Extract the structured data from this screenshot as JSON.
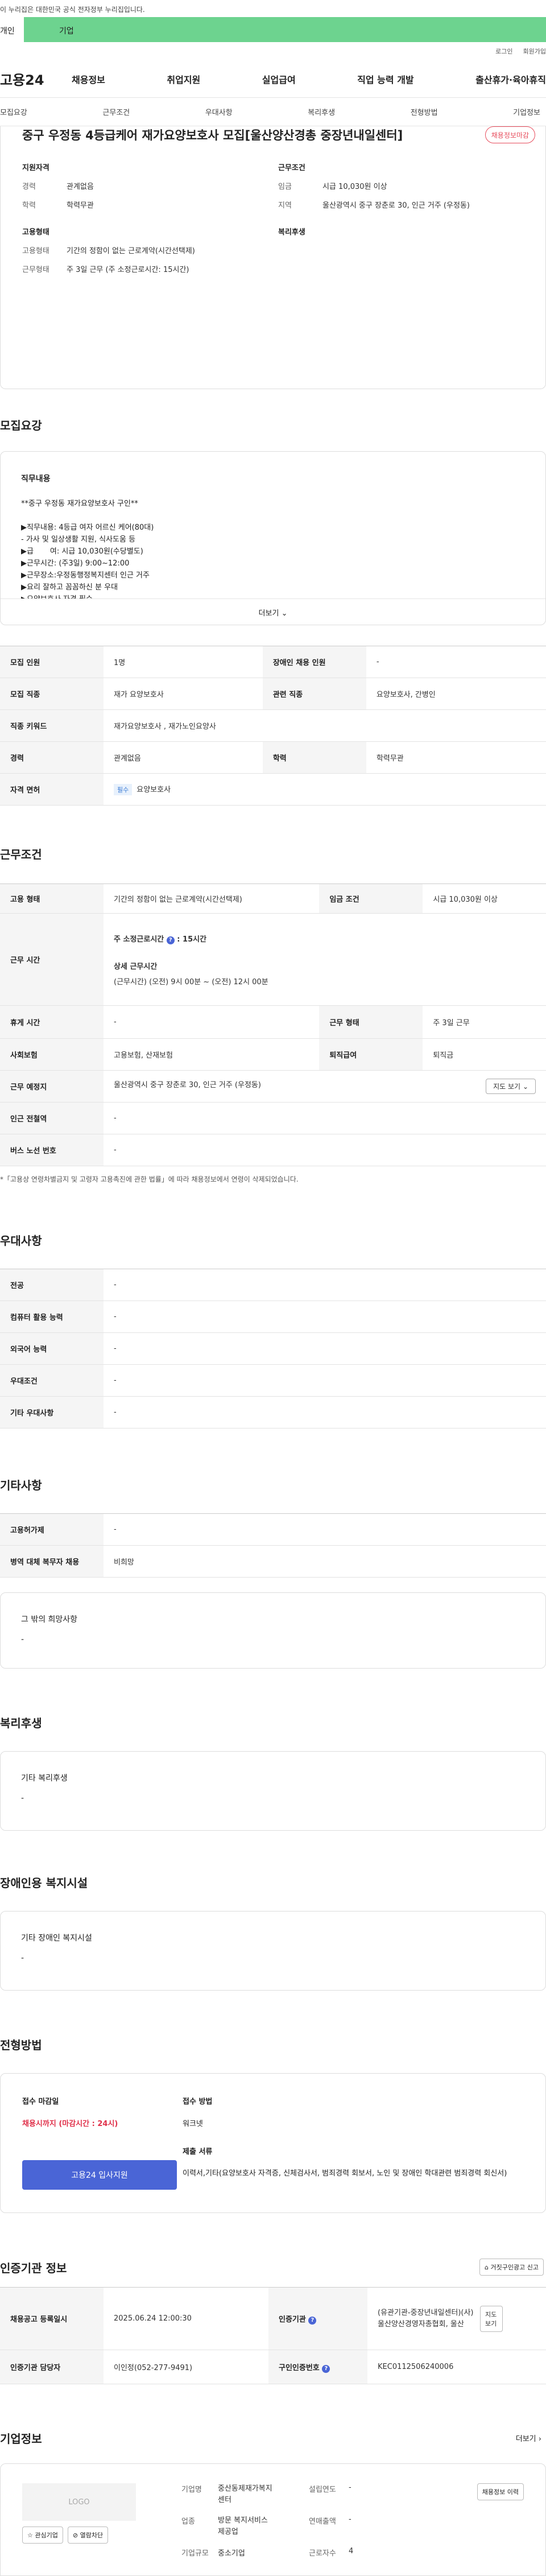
{
  "gov_notice": "이 누리집은 대한민국 공식 전자정부 누리집입니다.",
  "top_tabs": [
    "개인",
    "기업"
  ],
  "util_links": [
    "로그인",
    "회원가입"
  ],
  "logo": "고용24",
  "gnb": [
    "채용정보",
    "취업지원",
    "실업급여",
    "직업 능력 개발",
    "출산휴가·육아휴직"
  ],
  "subnav": [
    "모집요강",
    "근무조건",
    "우대사항",
    "복리후생",
    "전형방법",
    "기업정보"
  ],
  "job_title": "중구 우정동 4등급케어 재가요양보호사 모집[울산양산경총 중장년내일센터]",
  "status_badge": "채용정보마감",
  "summary": {
    "qual_title": "지원자격",
    "career_k": "경력",
    "career_v": "관계없음",
    "edu_k": "학력",
    "edu_v": "학력무관",
    "work_title": "근무조건",
    "wage_k": "임금",
    "wage_v": "시급 10,030원 이상",
    "region_k": "지역",
    "region_v": "울산광역시 중구 장춘로 30, 인근 거주 (우정동)",
    "emp_title": "고용형태",
    "emptype_k": "고용형태",
    "emptype_v": "기간의 정함이 없는 근로계약(시간선택제)",
    "hours_k": "근무형태",
    "hours_v": "주 3일 근무 (주 소정근로시간: 15시간)",
    "welfare_title": "복리후생"
  },
  "sections": {
    "recruit": "모집요강",
    "work": "근무조건",
    "pref": "우대사항",
    "etc": "기타사항",
    "welfare": "복리후생",
    "disabled": "장애인용 복지시설",
    "process": "전형방법",
    "agency": "인증기관 정보",
    "company": "기업정보"
  },
  "desc": {
    "heading": "직무내용",
    "lines": [
      "**중구 우정동 재가요양보호사 구인**",
      "",
      "▶직무내용: 4등급 여자 어르신 케어(80대)",
      " - 가사 및 일상생활 지원, 식사도움 등",
      "▶급       여: 시급 10,030원(수당별도)",
      "▶근무시간: (주3일) 9:00~12:00",
      "▶근무장소:우정동행정복지센터 인근 거주",
      "▶요리 잘하고 꼼꼼하신 분 우대",
      "▶요양보호사 자격 필수"
    ],
    "more_label": "더보기"
  },
  "recruit_table": {
    "count_k": "모집 인원",
    "count_v": "1명",
    "disabled_k": "장애인 채용 인원",
    "disabled_v": "-",
    "job_k": "모집 직종",
    "job_v": "재가 요양보호사",
    "rel_k": "관련 직종",
    "rel_v": "요양보호사, 간병인",
    "kw_k": "직종 키워드",
    "kw_v": "재가요양보호사 , 재가노인요양사",
    "career_k": "경력",
    "career_v": "관계없음",
    "edu_k": "학력",
    "edu_v": "학력무관",
    "lic_k": "자격 면허",
    "lic_chip": "필수",
    "lic_v": "요양보호사"
  },
  "work_table": {
    "type_k": "고용 형태",
    "type_v": "기간의 정함이 없는 근로계약(시간선택제)",
    "wage_k": "임금 조건",
    "wage_v": "시급 10,030원 이상",
    "time_k": "근무 시간",
    "weekly_label": "주 소정근로시간",
    "weekly_v": "15시간",
    "detail_label": "상세 근무시간",
    "detail_v": "(근무시간) (오전) 9시 00분 ~ (오전) 12시 00분",
    "break_k": "휴게 시간",
    "break_v": "-",
    "form_k": "근무 형태",
    "form_v": "주 3일 근무",
    "ins_k": "사회보험",
    "ins_v": "고용보험, 산재보험",
    "ret_k": "퇴직급여",
    "ret_v": "퇴직금",
    "place_k": "근무 예정지",
    "place_v": "울산광역시 중구 장춘로 30, 인근 거주 (우정동)",
    "map_btn": "지도 보기",
    "subway_k": "인근 전철역",
    "subway_v": "-",
    "bus_k": "버스 노선 번호",
    "bus_v": "-"
  },
  "work_note": "*「고용상 연령차별금지 및 고령자 고용촉진에 관한 법률」에 따라 채용정보에서 연령이 삭제되었습니다.",
  "pref_table": {
    "major_k": "전공",
    "major_v": "-",
    "pc_k": "컴퓨터 활용 능력",
    "pc_v": "-",
    "lang_k": "외국어 능력",
    "lang_v": "-",
    "cond_k": "우대조건",
    "cond_v": "-",
    "other_k": "기타 우대사항",
    "other_v": "-"
  },
  "etc_table": {
    "period_k": "고용허가제",
    "period_v": "-",
    "mil_k": "병역 대체 복무자 채용",
    "mil_v": "비희망"
  },
  "etc_box": {
    "title": "그 밖의 희망사항",
    "value": "-"
  },
  "welfare_box": {
    "title": "기타 복리후생",
    "value": "-"
  },
  "disabled_box": {
    "title": "기타 장애인 복지시설",
    "value": "-"
  },
  "process": {
    "deadline_label": "접수 마감일",
    "deadline_v": "채용시까지 (마감시간 : 24시)",
    "method_label": "접수 방법",
    "method_v": "워크넷",
    "docs_label": "제출 서류",
    "docs_v": "이력서,기타(요양보호사 자격증, 신체검사서, 범죄경력 회보서, 노인 및 장애인 학대관련 범죄경력 회신서)",
    "apply_btn": "고용24 입사지원"
  },
  "agency": {
    "report_btn": "거짓구인광고 신고",
    "reg_k": "채용공고 등록일시",
    "reg_v": "2025.06.24 12:00:30",
    "org_k": "인증기관",
    "org_v": "(유관기관-중장년내일센터)(사)울산양산경영자총협회, 울산",
    "map_btn": "지도 보기",
    "mgr_k": "인증기관 담당자",
    "mgr_v": "이인정(052-277-9491)",
    "no_k": "구인인증번호",
    "no_v": "KEC0112506240006"
  },
  "company": {
    "more_label": "더보기",
    "logo_text": "LOGO",
    "fav_btn": "관심기업",
    "block_btn": "열람차단",
    "name_k": "기업명",
    "name_v": "중산동제재가복지센터",
    "ind_k": "업종",
    "ind_v": "방문 복지서비스 제공업",
    "size_k": "기업규모",
    "size_v": "중소기업",
    "est_k": "설립연도",
    "est_v": "-",
    "sales_k": "연매출액",
    "sales_v": "-",
    "emp_k": "근로자수",
    "emp_v": "4",
    "list_btn": "채용정보 이력"
  }
}
